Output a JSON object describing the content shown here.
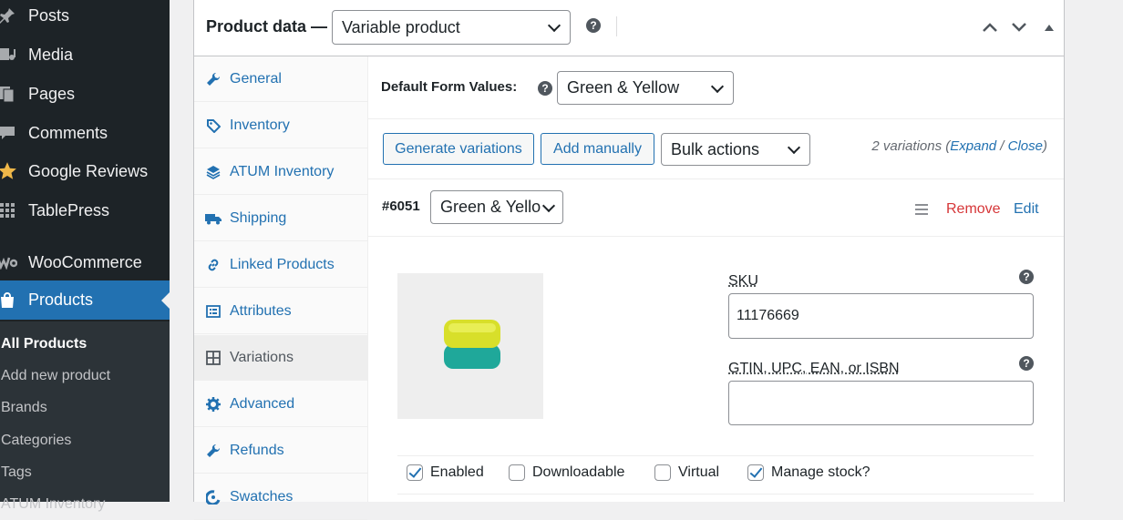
{
  "sidebar": {
    "items": [
      {
        "label": "Posts",
        "icon": "pin-icon"
      },
      {
        "label": "Media",
        "icon": "media-icon"
      },
      {
        "label": "Pages",
        "icon": "pages-icon"
      },
      {
        "label": "Comments",
        "icon": "comment-icon"
      },
      {
        "label": "Google Reviews",
        "icon": "star-icon"
      },
      {
        "label": "TablePress",
        "icon": "table-icon"
      },
      {
        "label": "WooCommerce",
        "icon": "woo-icon"
      },
      {
        "label": "Products",
        "icon": "bag-icon"
      }
    ],
    "submenu": [
      "All Products",
      "Add new product",
      "Brands",
      "Categories",
      "Tags",
      "ATUM Inventory"
    ]
  },
  "header": {
    "title": "Product data —",
    "product_type": "Variable product"
  },
  "tabs": [
    "General",
    "Inventory",
    "ATUM Inventory",
    "Shipping",
    "Linked Products",
    "Attributes",
    "Variations",
    "Advanced",
    "Refunds",
    "Swatches"
  ],
  "defaults": {
    "label": "Default Form Values:",
    "value": "Green & Yellow"
  },
  "toolbar": {
    "generate": "Generate variations",
    "add_manually": "Add manually",
    "bulk_actions": "Bulk actions",
    "count_text": "2 variations (",
    "expand": "Expand",
    "separator": " / ",
    "close": "Close",
    "count_end": ")"
  },
  "variation": {
    "id": "#6051",
    "attribute_value": "Green & Yello",
    "remove": "Remove",
    "edit": "Edit",
    "sku_label": "SKU",
    "sku_value": "11176669",
    "gtin_label": "GTIN, UPC, EAN, or ISBN",
    "gtin_value": "",
    "options": [
      {
        "label": "Enabled",
        "checked": true
      },
      {
        "label": "Downloadable",
        "checked": false
      },
      {
        "label": "Virtual",
        "checked": false
      },
      {
        "label": "Manage stock?",
        "checked": true
      }
    ]
  },
  "colors": {
    "accent": "#2271b1",
    "danger": "#d63638",
    "sidebar_bg": "#1d2327"
  }
}
